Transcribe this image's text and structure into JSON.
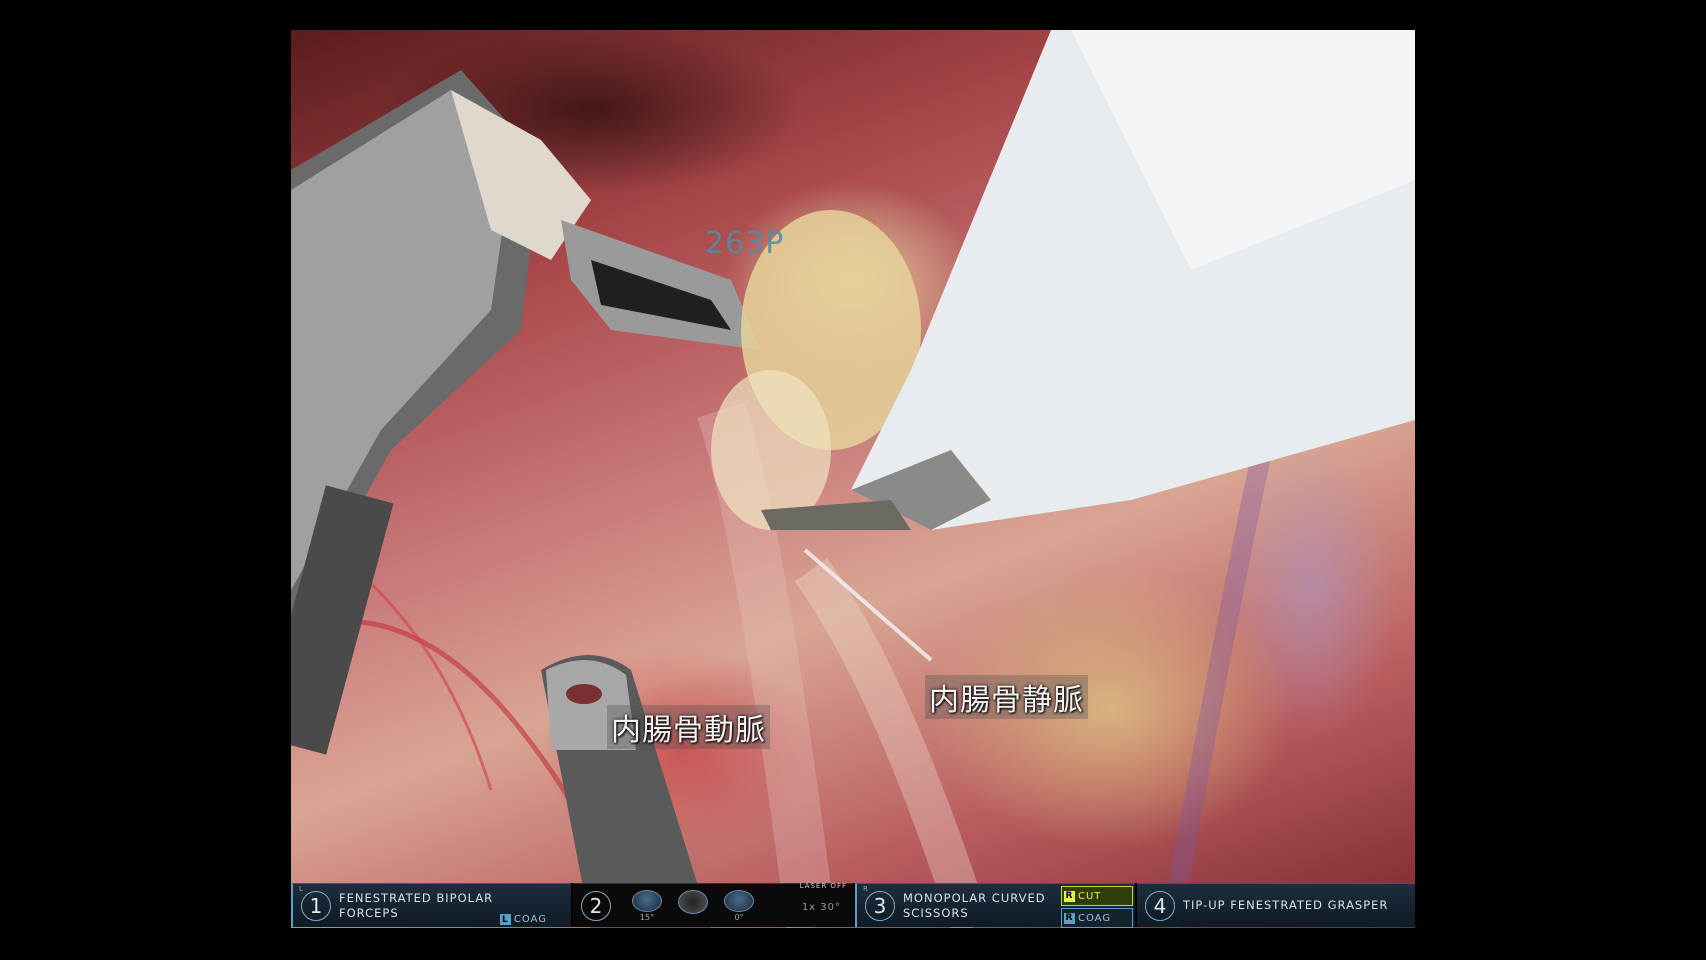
{
  "video": {
    "id_label": "263P",
    "annotations": {
      "artery": "内腸骨動脈",
      "vein": "内腸骨静脈"
    }
  },
  "instruments": [
    {
      "arm": "1",
      "side": "L",
      "name_line1": "FENESTRATED BIPOLAR",
      "name_line2": "FORCEPS",
      "energy": {
        "key": "L",
        "label": "COAG"
      }
    },
    {
      "arm": "2",
      "camera": {
        "left_deg": "15°",
        "right_deg": "0°",
        "laser": "LASER OFF",
        "zoom": "1x 30°"
      }
    },
    {
      "arm": "3",
      "side": "R",
      "name_line1": "MONOPOLAR CURVED",
      "name_line2": "SCISSORS",
      "energy": {
        "cut_key": "R",
        "cut": "CUT",
        "coag_key": "R",
        "coag": "COAG"
      }
    },
    {
      "arm": "4",
      "name_line1": "TIP-UP FENESTRATED GRASPER"
    }
  ],
  "colors": {
    "accent": "#5aa0c8",
    "cut_active": "#e8f04a"
  }
}
